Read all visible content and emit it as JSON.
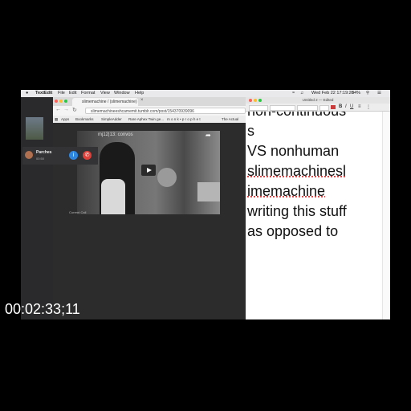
{
  "menubar": {
    "apple": "",
    "app": "TextEdit",
    "items": [
      "File",
      "Edit",
      "Format",
      "View",
      "Window",
      "Help"
    ],
    "clock": "Wed Feb 22 17:19:26",
    "battery": "84%"
  },
  "browser": {
    "tab_title": "slimemachine / (slimemachine)",
    "url": "slimemachineeshcamemit.tumblr.com/post/154370939096",
    "bookmarks": [
      "Apps",
      "Bookmarks",
      "SimpleAdder",
      "Rare Aphex Twin ge...",
      "m o n k • p r o p h e t",
      "The Actual"
    ],
    "post_title": "mj12|13: convos"
  },
  "call": {
    "status": "Current Call",
    "name": "Parches",
    "time": "00:50"
  },
  "textedit": {
    "window_title": "Untitled 2 — Edited",
    "lines": [
      "non-continuous",
      "s",
      "VS nonhuman",
      "slimemachinesl",
      "imemachine",
      "writing this stuff",
      "as opposed to"
    ]
  },
  "timecode": "00:02:33;11",
  "colors": {
    "background": "#000000",
    "decline": "#e0403a",
    "accept": "#2e86de",
    "spell_underline": "#e03030"
  }
}
